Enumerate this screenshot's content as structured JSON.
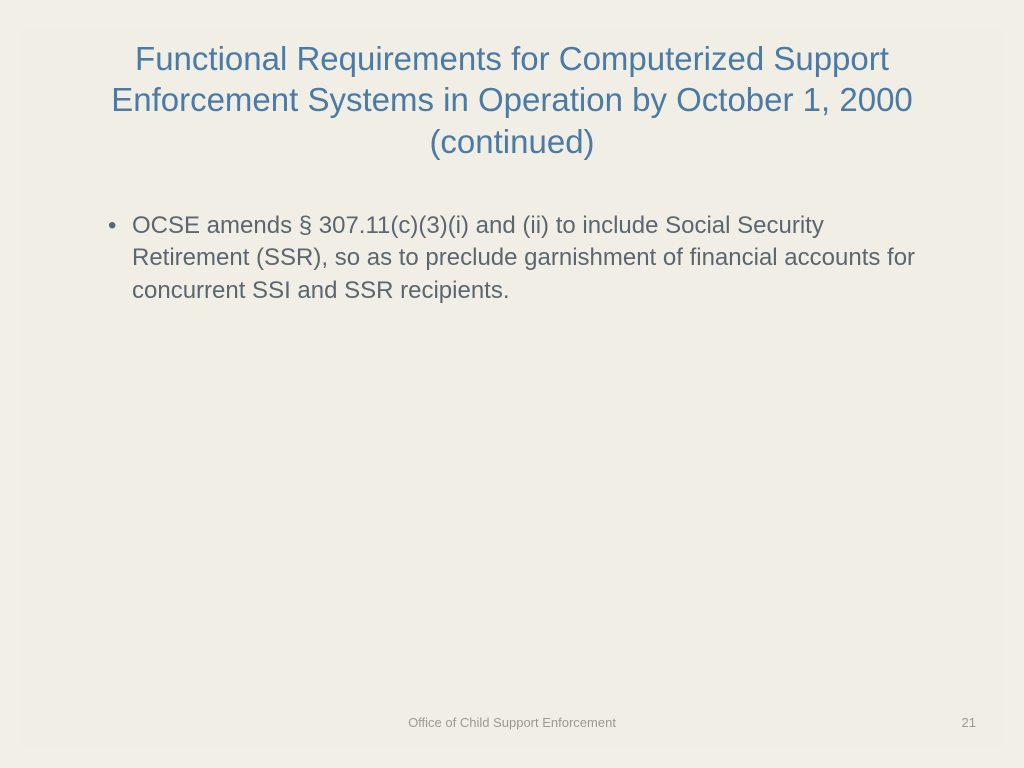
{
  "slide": {
    "title": "Functional Requirements for Computerized Support Enforcement Systems in Operation by October 1, 2000 (continued)",
    "bullets": [
      "OCSE amends § 307.11(c)(3)(i) and (ii) to include Social Security Retirement (SSR), so as to preclude garnishment of financial accounts for concurrent SSI and SSR recipients."
    ],
    "footer": "Office of Child Support Enforcement",
    "page_number": "21"
  }
}
